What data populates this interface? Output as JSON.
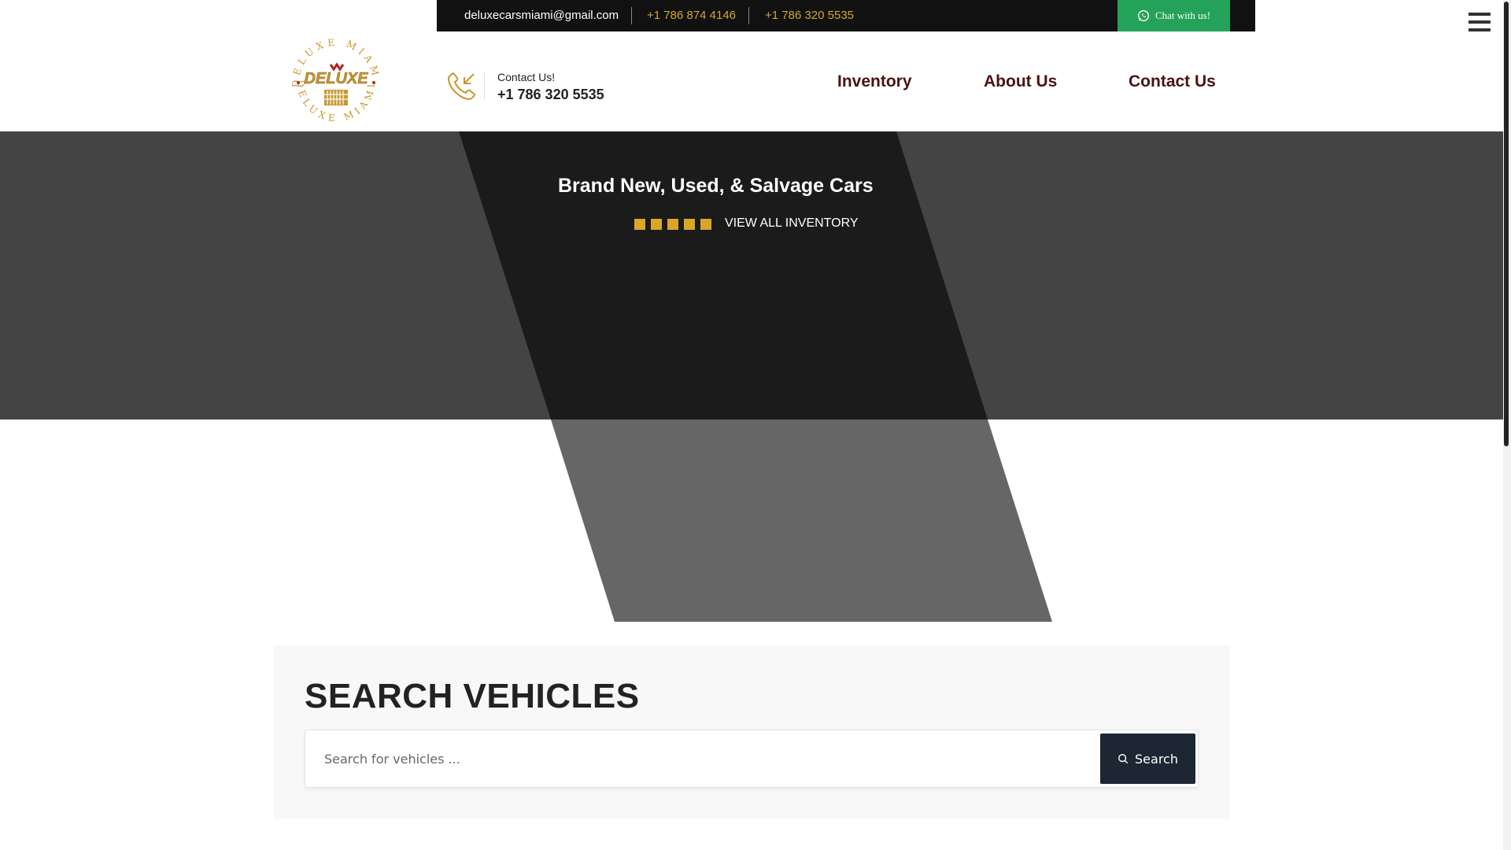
{
  "topbar": {
    "email": "deluxecarsmiami@gmail.com",
    "phone1": "+1 786 874 4146",
    "phone2": "+1 786 320 5535",
    "chat_label": "Chat with us!",
    "chat_icon": "whatsapp-icon"
  },
  "header": {
    "logo_text": "DELUXE",
    "logo_ring_text": "DELUXE MIAMI",
    "contact_label": "Contact Us!",
    "contact_phone": "+1 786 320 5535",
    "contact_icon": "phone-incoming-icon",
    "menu_icon": "hamburger-menu-icon"
  },
  "nav": {
    "items": [
      {
        "label": "Inventory"
      },
      {
        "label": "About Us"
      },
      {
        "label": "Contact Us"
      }
    ]
  },
  "hero": {
    "title": "Brand New, Used, & Salvage Cars",
    "cta_label": "VIEW ALL INVENTORY"
  },
  "search": {
    "heading": "SEARCH VEHICLES",
    "placeholder": "Search for vehicles ...",
    "button_label": "Search",
    "button_icon": "search-icon"
  },
  "colors": {
    "accent_gold": "#d4a62a",
    "nav_text": "#4a1313",
    "chat_green": "#25a25a",
    "search_button": "#1c2733"
  }
}
